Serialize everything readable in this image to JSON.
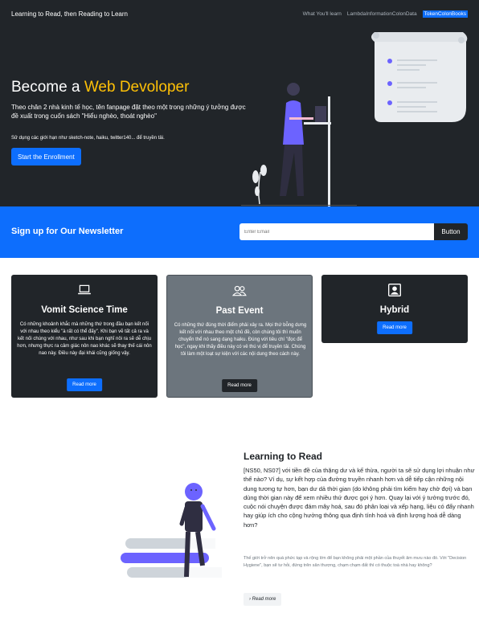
{
  "navbar": {
    "brand": "Learning to Read, then Reading to Learn",
    "links": [
      {
        "label": "What You'll learn",
        "active": false
      },
      {
        "label": "LambdaInformationColonData",
        "active": false
      },
      {
        "label": "TokenColonBooks",
        "active": true
      }
    ]
  },
  "hero": {
    "title_prefix": "Become a",
    "title_accent": "Web Devoloper",
    "lead": "Theo chân 2 nhà kinh tế học, tên fanpage đặt theo một trong những ý tưởng được đề xuất trong cuốn sách \"Hiểu nghèo, thoát nghèo\"",
    "small": "Sử dụng các giới hạn như sketch-note, haiku, twitter140... để truyền tải.",
    "button": "Start the Enrollment"
  },
  "newsletter": {
    "title": "Sign up for Our Newsletter",
    "placeholder": "Enter Email",
    "button": "Button"
  },
  "cards": [
    {
      "icon": "laptop-icon",
      "title": "Vomit Science Time",
      "text": "Có những khoảnh khắc mà những thứ trong đầu bạn kết nối với nhau theo kiểu \"à rất có thể đấy\". Khi bạn vẽ tất cả ra và kết nối chúng với nhau, như sau khi bạn nghĩ nôi ra sẽ dễ chịu hơn, nhưng thực ra cảm giác nôn nao khác sẽ thay thế cái nôn nao này. Điều này đại khái cũng giống vậy.",
      "button": "Read more"
    },
    {
      "icon": "people-icon",
      "title": "Past Event",
      "text": "Có những thứ đúng thời điểm phải xảy ra. Mọi thứ bỗng dưng kết nối với nhau theo một chủ đề, còn chúng tôi thì muốn chuyển thể nó sang dạng haiku. Đúng với tiêu chí \"đọc để học\", ngay khi thấy điều này có vẻ thú vị để truyền tải. Chúng tôi làm một loạt sự kiện với các nội dung theo cách này.",
      "button": "Read more"
    },
    {
      "icon": "person-badge-icon",
      "title": "Hybrid",
      "text": "",
      "button": "Read more"
    }
  ],
  "learning": {
    "title": "Learning to Read",
    "lead": "[NS50, NS07] với tiền đề của thặng dư và kế thừa, người ta sẽ sử dụng lợi nhuận như thế nào? Ví dụ, sự kết hợp của đường truyền nhanh hơn và dễ tiếp cận những nội dung tương tự hơn, bạn dư dả thời gian (do không phải tìm kiếm hay chờ đợi) và bạn dùng thời gian này để xem nhiều thứ được gợi ý hơn. Quay lại với ý tưởng trước đó, cuộc nói chuyện được đám mây hoá, sau đó phân loại và xếp hạng, liệu có đẩy nhanh hay giúp ích cho cộng hưởng thông qua định tính hoá và định lượng hoá dễ dàng hơn?",
    "muted": "Thế giới trở nên quá phức tạp và rộng lớn để bạn không phải một phần của thuyết âm mưu nào đó. Với \"Decision Hygiene\", bạn sẽ tư hỏi, đứng trên sân thượng, chạm chạm đất thì có thuộc toà nhà hay không?",
    "button": "Read more"
  },
  "colors": {
    "dark": "#212529",
    "primary": "#0d6efd",
    "accent": "#ffc107",
    "secondary": "#6c757d",
    "illustration_purple": "#6c63ff"
  }
}
